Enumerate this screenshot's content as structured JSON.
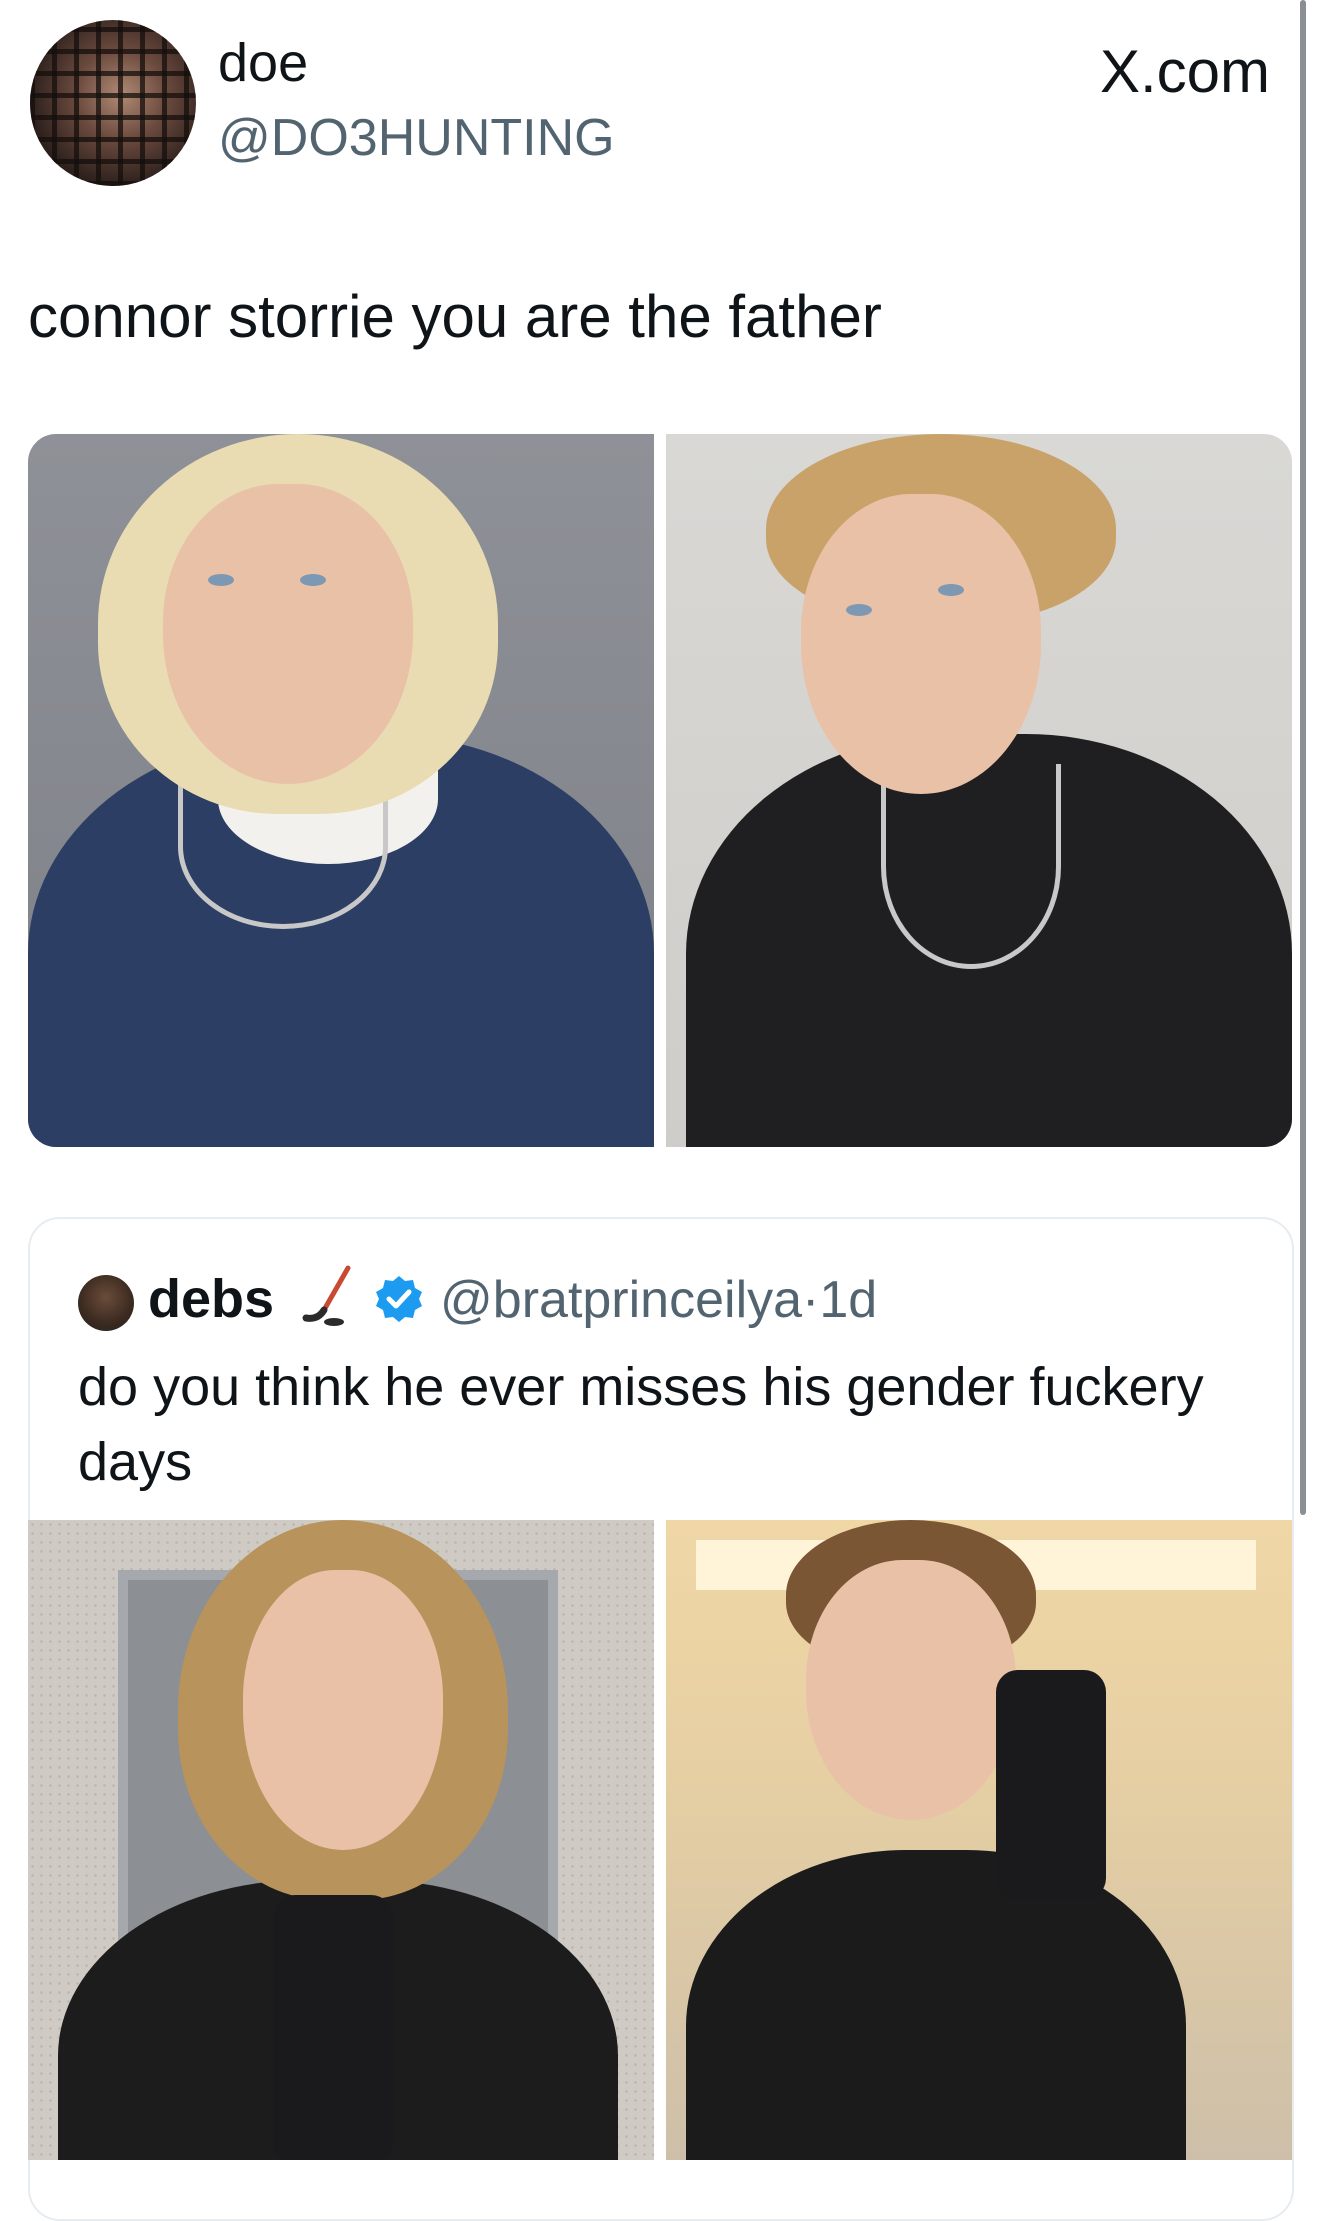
{
  "tweet": {
    "author_name": "doe",
    "author_handle": "@DO3HUNTING",
    "text": "connor storrie you are the father",
    "brand": "X.com"
  },
  "quoted_tweet": {
    "author_name": "debs",
    "emoji": "hockey-stick-icon",
    "verified": true,
    "handle": "@bratprinceilya",
    "separator": "·",
    "time": "1d",
    "text": "do you think he ever misses his gender fuckery days"
  },
  "colors": {
    "text": "#0f1419",
    "secondary": "#536471",
    "verified": "#1d9bf0",
    "border": "#e6ecf0"
  }
}
